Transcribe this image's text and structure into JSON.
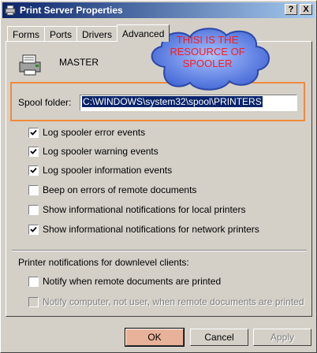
{
  "window": {
    "title": "Print Server Properties",
    "help_button": "?",
    "close_button": "X"
  },
  "tabs": [
    {
      "label": "Forms"
    },
    {
      "label": "Ports"
    },
    {
      "label": "Drivers"
    },
    {
      "label": "Advanced"
    }
  ],
  "server": {
    "name": "MASTER"
  },
  "spool": {
    "label": "Spool folder:",
    "value": "C:\\WINDOWS\\system32\\spool\\PRINTERS"
  },
  "options": [
    {
      "label": "Log spooler error events",
      "checked": true,
      "disabled": false
    },
    {
      "label": "Log spooler warning events",
      "checked": true,
      "disabled": false
    },
    {
      "label": "Log spooler information events",
      "checked": true,
      "disabled": false
    },
    {
      "label": "Beep on errors of remote documents",
      "checked": false,
      "disabled": false
    },
    {
      "label": "Show informational notifications for local printers",
      "checked": false,
      "disabled": false
    },
    {
      "label": "Show informational notifications for network printers",
      "checked": true,
      "disabled": false
    }
  ],
  "downlevel": {
    "label": "Printer notifications for downlevel clients:",
    "options": [
      {
        "label": "Notify when remote documents are printed",
        "checked": false,
        "disabled": false
      },
      {
        "label": "Notify computer, not user, when remote documents are printed",
        "checked": false,
        "disabled": true
      }
    ]
  },
  "buttons": {
    "ok": "OK",
    "cancel": "Cancel",
    "apply": "Apply"
  },
  "annotation": {
    "lines": [
      "THISI IS THE",
      "RESOURCE OF",
      "SPOOLER"
    ],
    "text_color": "#ff1a1a",
    "cloud_color": "#5b7fe0",
    "outline_color": "#f08a3a"
  }
}
